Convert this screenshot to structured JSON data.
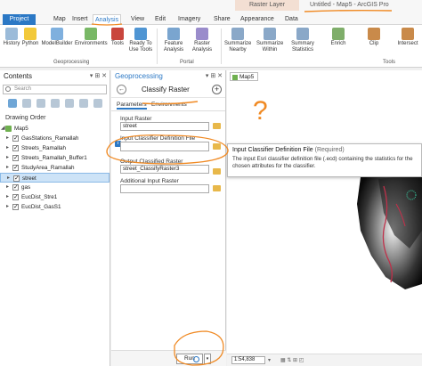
{
  "title_bar": {
    "context_tab": "Raster Layer",
    "app_title": "Untitled - Map5 - ArcGIS Pro"
  },
  "ribbon_tabs": [
    "Project",
    "Map",
    "Insert",
    "Analysis",
    "View",
    "Edit",
    "Imagery",
    "Share",
    "Appearance",
    "Data"
  ],
  "ribbon": {
    "geoprocessing_buttons": [
      "History",
      "Python",
      "ModelBuilder",
      "Environments",
      "Tools"
    ],
    "ready_to_use": "Ready To Use Tools",
    "portal_buttons": [
      "Feature Analysis",
      "Raster Analysis"
    ],
    "tools_buttons": [
      "Summarize Nearby",
      "Summarize Within",
      "Summary Statistics",
      "Enrich",
      "Clip",
      "Intersect"
    ],
    "groups": [
      "Geoprocessing",
      "Portal",
      "Tools"
    ]
  },
  "contents": {
    "title": "Contents",
    "search_placeholder": "Search",
    "section_label": "Drawing Order",
    "map_name": "Map5",
    "layers": [
      "GasStations_Ramallah",
      "Streets_Ramallah",
      "Streets_Ramallah_Buffer1",
      "StudyArea_Ramallah",
      "street",
      "gas",
      "EucDist_Stre1",
      "EucDist_GasS1"
    ],
    "selected_layer": "street"
  },
  "geoprocessing": {
    "title": "Geoprocessing",
    "tool_name": "Classify Raster",
    "tabs": [
      "Parameters",
      "Environments"
    ],
    "fields": {
      "input_raster_label": "Input Raster",
      "input_raster_value": "street",
      "classifier_label": "Input Classifier Definition File",
      "classifier_value": "",
      "output_label": "Output Classified Raster",
      "output_value": "street_ClassifyRaster3",
      "additional_label": "Additional Input Raster",
      "additional_value": ""
    },
    "run_label": "Run"
  },
  "map": {
    "tab_label": "Map5",
    "scale": "1:54,838"
  },
  "tooltip": {
    "title": "Input Classifier Definition File",
    "required": "(Required)",
    "body": "The input Esri classifier definition file (.ecd) containing the statistics for the chosen attributes for the classifier."
  },
  "annotation_text": "?",
  "colors": {
    "accent": "#2b78c5",
    "annotation": "#f08a24"
  }
}
